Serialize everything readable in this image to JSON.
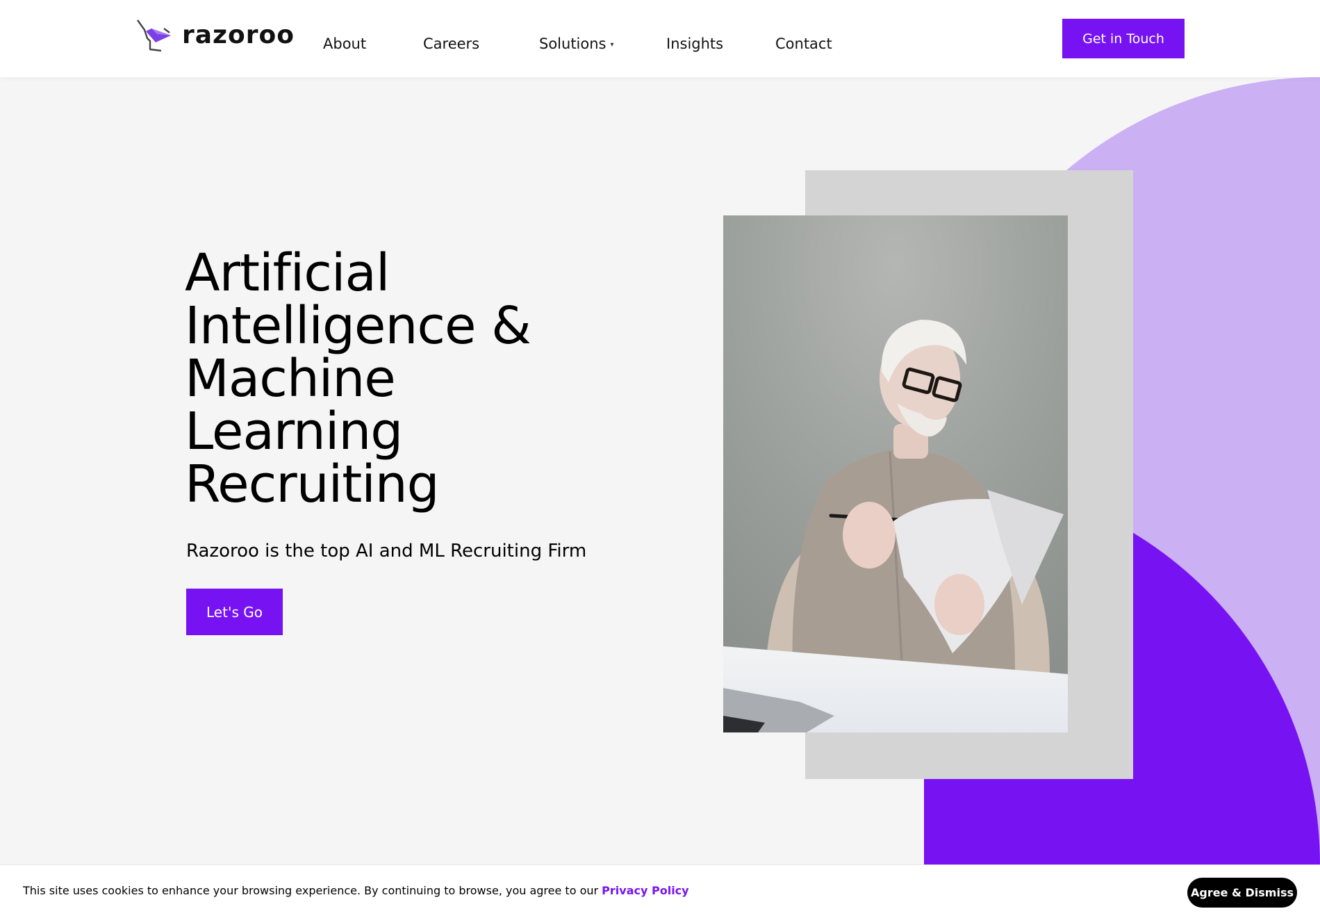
{
  "header": {
    "brand": "razoroo",
    "logo_icon": "kangaroo-paper-plane-icon",
    "nav": [
      {
        "label": "About"
      },
      {
        "label": "Careers"
      },
      {
        "label": "Solutions",
        "has_dropdown": true,
        "caret": "▾"
      },
      {
        "label": "Insights"
      },
      {
        "label": "Contact"
      }
    ],
    "cta_label": "Get in Touch"
  },
  "hero": {
    "headline_lines": [
      "Artificial",
      "Intelligence &",
      "Machine",
      "Learning",
      "Recruiting"
    ],
    "subtitle": "Razoroo is the top AI and ML Recruiting Firm",
    "cta_label": "Let's Go",
    "image_alt": "Man with white hair and glasses reading documents at a desk"
  },
  "cookie": {
    "text": "This site uses cookies to enhance your browsing experience. By continuing to browse, you agree to our ",
    "link_label": "Privacy Policy",
    "button_label": "Agree & Dismiss"
  },
  "colors": {
    "accent": "#7713f2",
    "accent_light": "#ccb0f4",
    "hero_bg": "#f5f5f5",
    "frame_gray": "#d4d4d4"
  }
}
